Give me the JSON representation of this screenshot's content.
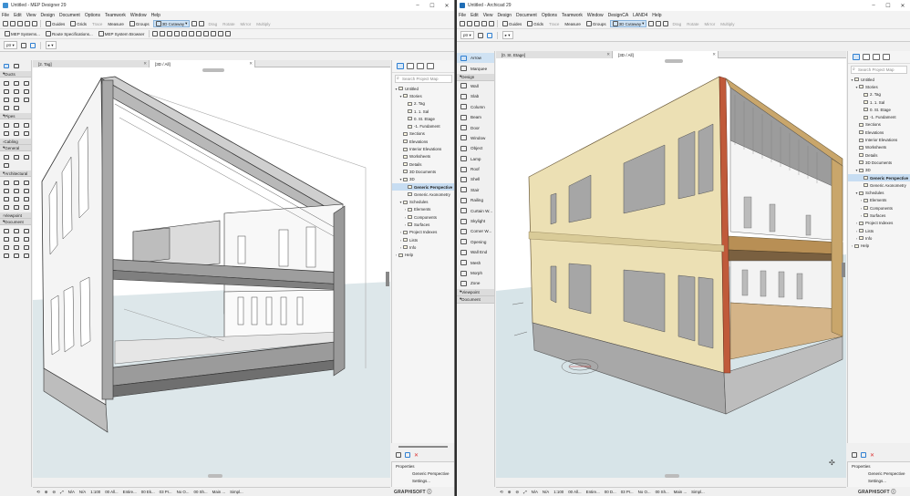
{
  "left": {
    "title": "Untitled - MEP Designer 29",
    "menu": [
      "File",
      "Edit",
      "View",
      "Design",
      "Document",
      "Options",
      "Teamwork",
      "Window",
      "Help"
    ],
    "toolbar1": [
      "Guides",
      "Grids",
      "Measure",
      "Groups",
      "3D Cutaway",
      "Drag",
      "Rotate",
      "Mirror",
      "Multiply"
    ],
    "toolbar2": [
      "MEP Systems...",
      "Route Specifications...",
      "MEP System Browser"
    ],
    "tabs": [
      "[2. Tag]",
      "[3D / All]"
    ],
    "toolbox_sections": [
      "Ducts",
      "Pipes",
      "Cabling",
      "General",
      "Architectural",
      "Viewpoint",
      "Document"
    ],
    "tree": [
      {
        "label": "Untitled",
        "level": 0,
        "arrow": "▾"
      },
      {
        "label": "Stories",
        "level": 1,
        "arrow": "▾"
      },
      {
        "label": "2. Tag",
        "level": 2,
        "arrow": ""
      },
      {
        "label": "1. 1. Sal",
        "level": 2,
        "arrow": ""
      },
      {
        "label": "0. St. Etage",
        "level": 2,
        "arrow": ""
      },
      {
        "label": "-1. Fundament",
        "level": 2,
        "arrow": ""
      },
      {
        "label": "Sections",
        "level": 1,
        "arrow": ""
      },
      {
        "label": "Elevations",
        "level": 1,
        "arrow": ""
      },
      {
        "label": "Interior Elevations",
        "level": 1,
        "arrow": ""
      },
      {
        "label": "Worksheets",
        "level": 1,
        "arrow": ""
      },
      {
        "label": "Details",
        "level": 1,
        "arrow": ""
      },
      {
        "label": "3D Documents",
        "level": 1,
        "arrow": ""
      },
      {
        "label": "3D",
        "level": 1,
        "arrow": "▾"
      },
      {
        "label": "Generic Perspective",
        "level": 2,
        "arrow": "",
        "selected": true
      },
      {
        "label": "Generic Axonometry",
        "level": 2,
        "arrow": ""
      },
      {
        "label": "Schedules",
        "level": 1,
        "arrow": "▾"
      },
      {
        "label": "Elements",
        "level": 2,
        "arrow": "›"
      },
      {
        "label": "Components",
        "level": 2,
        "arrow": "›"
      },
      {
        "label": "Surfaces",
        "level": 2,
        "arrow": "›"
      },
      {
        "label": "Project Indexes",
        "level": 1,
        "arrow": "›"
      },
      {
        "label": "Lists",
        "level": 1,
        "arrow": "›"
      },
      {
        "label": "Info",
        "level": 1,
        "arrow": "›"
      },
      {
        "label": "Help",
        "level": 0,
        "arrow": "›"
      }
    ],
    "props_title": "Properties",
    "props_value": "Generic Perspective",
    "props_settings": "Settings...",
    "status": [
      "N/A",
      "N/A",
      "1:100",
      "00 All...",
      "Entire...",
      "00 Ek...",
      "03 Pr...",
      "No O...",
      "00 Sh...",
      "Main ...",
      "Simpl..."
    ],
    "brand": "GRAPHISOFT ⓘ"
  },
  "right": {
    "title": "Untitled - Archicad 29",
    "menu": [
      "File",
      "Edit",
      "View",
      "Design",
      "Document",
      "Options",
      "Teamwork",
      "Window",
      "DesignCA",
      "LAND4",
      "Help"
    ],
    "toolbar1": [
      "Guides",
      "Grids",
      "Measure",
      "Groups",
      "3D Cutaway",
      "Drag",
      "Rotate",
      "Mirror",
      "Multiply"
    ],
    "tabs": [
      "[0. St. Etage]",
      "[3D / All]"
    ],
    "toolbox": [
      {
        "label": "Arrow",
        "selected": true
      },
      {
        "label": "Marquee"
      },
      {
        "label": "Design",
        "header": true
      },
      {
        "label": "Wall"
      },
      {
        "label": "Slab"
      },
      {
        "label": "Column"
      },
      {
        "label": "Beam"
      },
      {
        "label": "Door"
      },
      {
        "label": "Window"
      },
      {
        "label": "Object"
      },
      {
        "label": "Lamp"
      },
      {
        "label": "Roof"
      },
      {
        "label": "Shell"
      },
      {
        "label": "Stair"
      },
      {
        "label": "Railing"
      },
      {
        "label": "Curtain W..."
      },
      {
        "label": "Skylight"
      },
      {
        "label": "Corner W..."
      },
      {
        "label": "Opening"
      },
      {
        "label": "Wall End"
      },
      {
        "label": "Mesh"
      },
      {
        "label": "Morph"
      },
      {
        "label": "Zone"
      },
      {
        "label": "Viewpoint",
        "header": true
      },
      {
        "label": "Document",
        "header": true
      }
    ],
    "tree": [
      {
        "label": "Untitled",
        "level": 0,
        "arrow": "▾"
      },
      {
        "label": "Stories",
        "level": 1,
        "arrow": "▾"
      },
      {
        "label": "2. Tag",
        "level": 2,
        "arrow": ""
      },
      {
        "label": "1. 1. Sal",
        "level": 2,
        "arrow": ""
      },
      {
        "label": "0. St. Etage",
        "level": 2,
        "arrow": ""
      },
      {
        "label": "-1. Fundament",
        "level": 2,
        "arrow": ""
      },
      {
        "label": "Sections",
        "level": 1,
        "arrow": ""
      },
      {
        "label": "Elevations",
        "level": 1,
        "arrow": ""
      },
      {
        "label": "Interior Elevations",
        "level": 1,
        "arrow": ""
      },
      {
        "label": "Worksheets",
        "level": 1,
        "arrow": ""
      },
      {
        "label": "Details",
        "level": 1,
        "arrow": ""
      },
      {
        "label": "3D Documents",
        "level": 1,
        "arrow": ""
      },
      {
        "label": "3D",
        "level": 1,
        "arrow": "▾"
      },
      {
        "label": "Generic Perspective",
        "level": 2,
        "arrow": "",
        "selected": true
      },
      {
        "label": "Generic Axonometry",
        "level": 2,
        "arrow": ""
      },
      {
        "label": "Schedules",
        "level": 1,
        "arrow": "▾"
      },
      {
        "label": "Elements",
        "level": 2,
        "arrow": "›"
      },
      {
        "label": "Components",
        "level": 2,
        "arrow": "›"
      },
      {
        "label": "Surfaces",
        "level": 2,
        "arrow": "›"
      },
      {
        "label": "Project Indexes",
        "level": 1,
        "arrow": "›"
      },
      {
        "label": "Lists",
        "level": 1,
        "arrow": "›"
      },
      {
        "label": "Info",
        "level": 1,
        "arrow": "›"
      },
      {
        "label": "Help",
        "level": 0,
        "arrow": "›"
      }
    ],
    "props_title": "Properties",
    "props_value": "Generic Perspective",
    "props_settings": "Settings...",
    "status": [
      "N/A",
      "N/A",
      "1:100",
      "00 All...",
      "Entire...",
      "00 D...",
      "03 Pr...",
      "No O...",
      "00 Sh...",
      "Main ...",
      "Simpl..."
    ],
    "brand": "GRAPHISOFT ⓘ"
  },
  "colors": {
    "accent": "#2f7fd1",
    "facade": "#ece0b4",
    "ground": "#d9e5e8",
    "timber": "#c9a66b"
  }
}
